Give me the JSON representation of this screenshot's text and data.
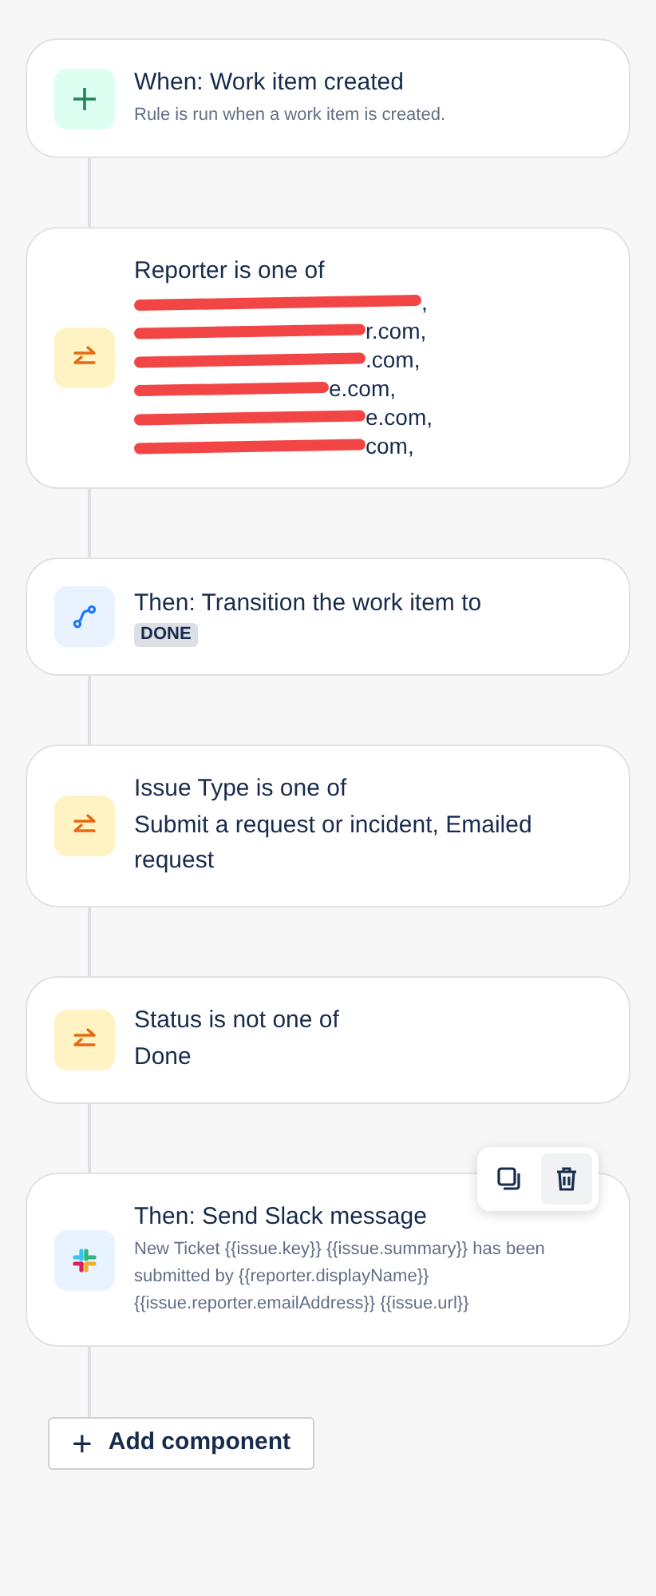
{
  "steps": [
    {
      "kind": "trigger",
      "title": "When: Work item created",
      "subtitle": "Rule is run when a work item is created."
    },
    {
      "kind": "condition",
      "title": "Reporter is one of",
      "redacted_lines": [
        ",",
        "r.com,",
        ".com,",
        "e.com,",
        "e.com,",
        "com,"
      ]
    },
    {
      "kind": "transition",
      "title": "Then: Transition the work item to",
      "status": "DONE"
    },
    {
      "kind": "condition",
      "title": "Issue Type is one of",
      "value": "Submit a request or incident, Emailed request"
    },
    {
      "kind": "condition",
      "title": "Status is not one of",
      "value": "Done"
    },
    {
      "kind": "slack",
      "title": "Then: Send Slack message",
      "subtitle": "New Ticket {{issue.key}} {{issue.summary}} has been submitted by {{reporter.displayName}} {{issue.reporter.emailAddress}} {{issue.url}}",
      "toolbar": true
    }
  ],
  "add_button": {
    "icon": "+",
    "label": "Add component"
  }
}
